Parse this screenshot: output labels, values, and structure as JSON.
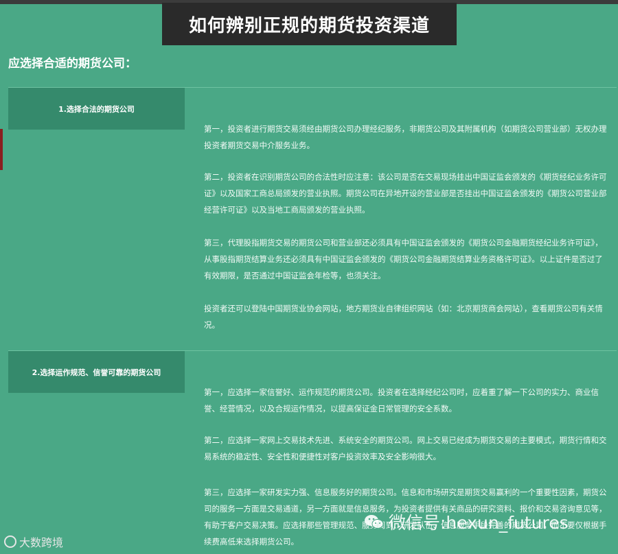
{
  "header": {
    "title": "如何辨别正规的期货投资渠道"
  },
  "subtitle": "应选择合适的期货公司：",
  "sections": [
    {
      "heading": "1.选择合法的期货公司",
      "paragraphs": [
        "第一，投资者进行期货交易须经由期货公司办理经纪服务，非期货公司及其附属机构（如期货公司营业部）无权办理投资者期货交易中介服务业务。",
        "第二，投资者在识别期货公司的合法性时应注意：该公司是否在交易现场挂出中国证监会颁发的《期货经纪业务许可证》以及国家工商总局颁发的营业执照。期货公司在异地开设的营业部是否挂出中国证监会颁发的《期货公司营业部经营许可证》以及当地工商局颁发的营业执照。",
        "第三，代理股指期货交易的期货公司和营业部还必须具有中国证监会颁发的《期货公司金融期货经纪业务许可证》，从事股指期货结算业务还必须具有中国证监会颁发的《期货公司金融期货结算业务资格许可证》。以上证件是否过了有效期限，是否通过中国证监会年检等，也须关注。",
        "投资者还可以登陆中国期货业协会网站，地方期货业自律组织网站（如：北京期货商会网站），查看期货公司有关情况。"
      ]
    },
    {
      "heading": "2.选择运作规范、信誉可靠的期货公司",
      "paragraphs": [
        "第一，应选择一家信誉好、运作规范的期货公司。投资者在选择经纪公司时，应着重了解一下公司的实力、商业信誉、经营情况，以及合规运作情况，以提高保证金日常管理的安全系数。",
        "第二，应选择一家网上交易技术先进、系统安全的期货公司。网上交易已经成为期货交易的主要模式，期货行情和交易系统的稳定性、安全性和便捷性对客户投资效率及安全影响很大。",
        "第三，应选择一家研发实力强、信息服务好的期货公司。信息和市场研究是期货交易赢利的一个重要性因素，期货公司的服务一方面是交易通道，另一方面就是信息服务，为投资者提供有关商品的研究资料、报价和交易咨询意见等，有助于客户交易决策。应选择那些管理规范、服务周到、研发队伍、信息服务手段完善的期货公司，而不要仅根据手续费高低来选择期货公司。"
      ]
    }
  ],
  "watermarks": {
    "left": "大数跨境",
    "right": "微信号:hexun_futures"
  }
}
